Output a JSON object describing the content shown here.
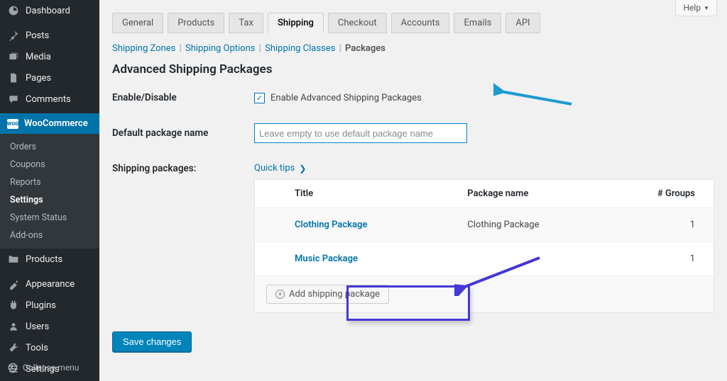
{
  "sidebar": {
    "items": [
      {
        "label": "Dashboard"
      },
      {
        "label": "Posts"
      },
      {
        "label": "Media"
      },
      {
        "label": "Pages"
      },
      {
        "label": "Comments"
      },
      {
        "label": "WooCommerce"
      },
      {
        "label": "Products"
      },
      {
        "label": "Appearance"
      },
      {
        "label": "Plugins"
      },
      {
        "label": "Users"
      },
      {
        "label": "Tools"
      },
      {
        "label": "Settings"
      }
    ],
    "submenu": [
      {
        "label": "Orders"
      },
      {
        "label": "Coupons"
      },
      {
        "label": "Reports"
      },
      {
        "label": "Settings"
      },
      {
        "label": "System Status"
      },
      {
        "label": "Add-ons"
      }
    ],
    "collapse_label": "Collapse menu"
  },
  "help_label": "Help",
  "tabs": [
    {
      "label": "General"
    },
    {
      "label": "Products"
    },
    {
      "label": "Tax"
    },
    {
      "label": "Shipping"
    },
    {
      "label": "Checkout"
    },
    {
      "label": "Accounts"
    },
    {
      "label": "Emails"
    },
    {
      "label": "API"
    }
  ],
  "subnav": {
    "zones": "Shipping Zones",
    "options": "Shipping Options",
    "classes": "Shipping Classes",
    "packages": "Packages"
  },
  "page_title": "Advanced Shipping Packages",
  "form": {
    "enable_label": "Enable/Disable",
    "enable_checkbox_label": "Enable Advanced Shipping Packages",
    "default_name_label": "Default package name",
    "default_name_placeholder": "Leave empty to use default package name",
    "default_name_value": "",
    "packages_label": "Shipping packages:",
    "quick_tips": "Quick tips"
  },
  "table": {
    "headers": {
      "title": "Title",
      "pkg": "Package name",
      "groups": "# Groups"
    },
    "rows": [
      {
        "title": "Clothing Package",
        "pkg": "Clothing Package",
        "groups": "1"
      },
      {
        "title": "Music Package",
        "pkg": "",
        "groups": "1"
      }
    ],
    "add_label": "Add shipping package"
  },
  "save_label": "Save changes",
  "colors": {
    "accent": "#0073aa",
    "arrow": "#1d9bd1",
    "highlight": "#4438d6"
  }
}
